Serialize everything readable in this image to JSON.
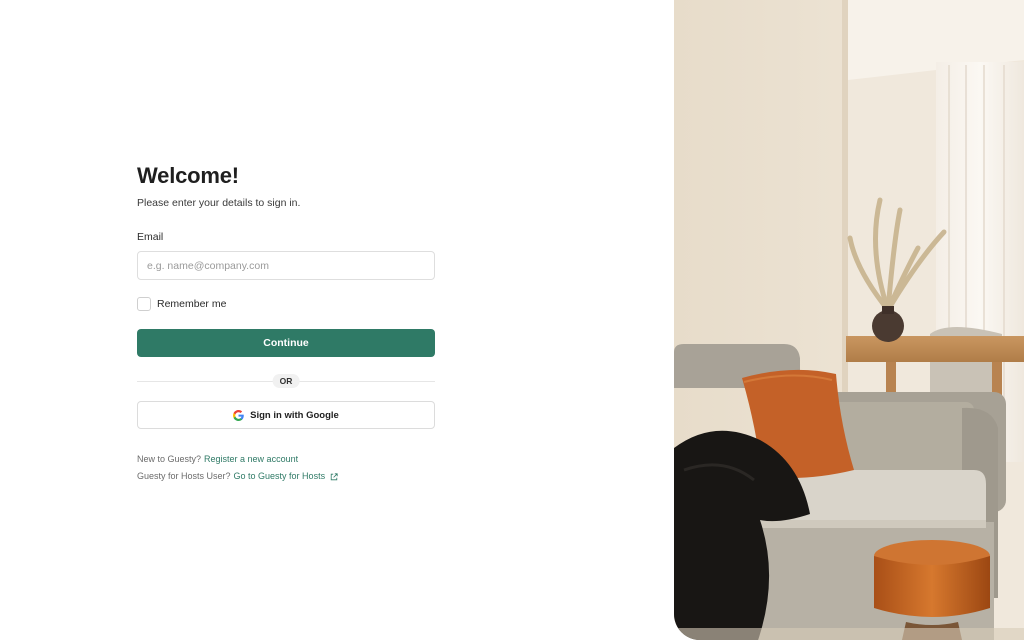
{
  "header": {
    "title": "Welcome!",
    "subtitle": "Please enter your details to sign in."
  },
  "email": {
    "label": "Email",
    "placeholder": "e.g. name@company.com",
    "value": ""
  },
  "remember": {
    "label": "Remember me",
    "checked": false
  },
  "continue_label": "Continue",
  "divider_label": "OR",
  "google": {
    "label": "Sign in with Google",
    "icon": "google-g-icon"
  },
  "footer": {
    "new_user_text": "New to Guesty?",
    "register_link": "Register a new account",
    "hosts_text": "Guesty for Hosts User?",
    "hosts_link": "Go to Guesty for Hosts",
    "hosts_link_icon": "external-link-icon"
  },
  "colors": {
    "accent": "#2f7a66",
    "border": "#dedede"
  }
}
